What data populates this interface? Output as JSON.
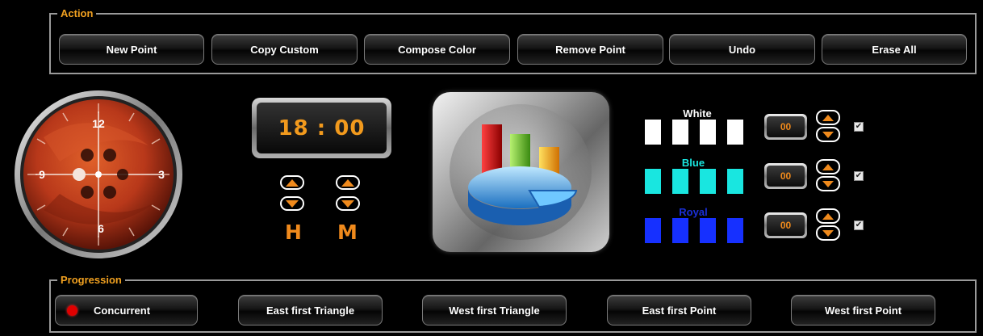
{
  "action": {
    "legend": "Action",
    "buttons": [
      "New Point",
      "Copy Custom",
      "Compose Color",
      "Remove Point",
      "Undo",
      "Erase All"
    ]
  },
  "clock": {
    "numerals": {
      "twelve": "12",
      "three": "3",
      "six": "6",
      "nine": "9"
    },
    "face_color": "#c0401a"
  },
  "time": {
    "display": "18 : 00",
    "hour_label": "H",
    "minute_label": "M"
  },
  "channels": [
    {
      "name": "White",
      "value": "00",
      "color": "#ffffff",
      "label_color": "#ffffff",
      "checked": true
    },
    {
      "name": "Blue",
      "value": "00",
      "color": "#19e6e0",
      "label_color": "#19e6e0",
      "checked": true
    },
    {
      "name": "Royal",
      "value": "00",
      "color": "#1630ff",
      "label_color": "#1a2fd6",
      "checked": true
    }
  ],
  "progression": {
    "legend": "Progression",
    "buttons": [
      "Concurrent",
      "East first Triangle",
      "West first Triangle",
      "East first Point",
      "West first Point"
    ],
    "selected": "Concurrent"
  },
  "colors": {
    "accent": "#f08a1c",
    "legend": "#f0a020"
  }
}
